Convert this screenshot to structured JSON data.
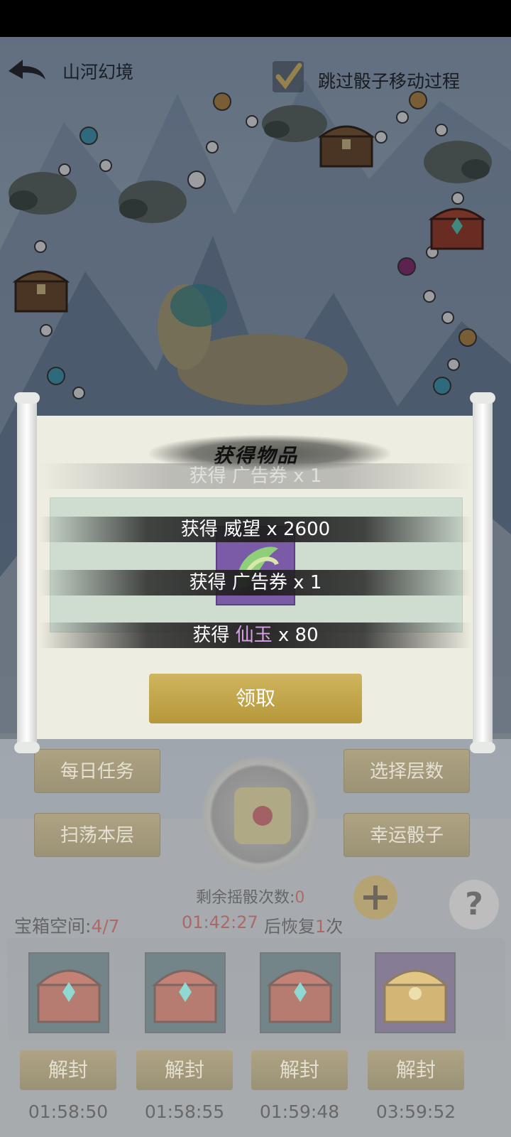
{
  "header": {
    "title": "山河幻境",
    "skip_label": "跳过骰子移动过程"
  },
  "popup": {
    "heading": "获得物品",
    "toasts": [
      {
        "prefix": "获得",
        "name": "广告券",
        "qty": "x 1"
      },
      {
        "prefix": "获得",
        "name": "威望",
        "qty": "x 2600"
      },
      {
        "prefix": "获得",
        "name": "广告券",
        "qty": "x 1"
      },
      {
        "prefix": "获得",
        "name": "仙玉",
        "qty": "x 80"
      }
    ],
    "claim_label": "领取"
  },
  "controls": {
    "daily_task": "每日任务",
    "sweep_floor": "扫荡本层",
    "select_floor": "选择层数",
    "lucky_dice": "幸运骰子",
    "remaining_label": "剩余摇骰次数:",
    "remaining_value": "0",
    "help": "?"
  },
  "chests": {
    "space_label": "宝箱空间:",
    "space_value": "4/7",
    "recover_timer": "01:42:27",
    "recover_prefix": "后恢复",
    "recover_count": "1",
    "recover_suffix": "次",
    "slots": [
      {
        "type": "red",
        "button": "解封",
        "time": "01:58:50"
      },
      {
        "type": "red",
        "button": "解封",
        "time": "01:58:55"
      },
      {
        "type": "red",
        "button": "解封",
        "time": "01:59:48"
      },
      {
        "type": "gold",
        "button": "解封",
        "time": "03:59:52"
      }
    ]
  },
  "colors": {
    "accent_red": "#8c1e18",
    "purple_item": "#d7a0e6",
    "gold_button": "#cfb55e"
  },
  "icons": [
    "back-arrow-icon",
    "checkmark-icon",
    "dragon-icon",
    "treasure-chest-icon",
    "qilin-icon",
    "dice-icon",
    "plus-icon",
    "help-icon"
  ]
}
